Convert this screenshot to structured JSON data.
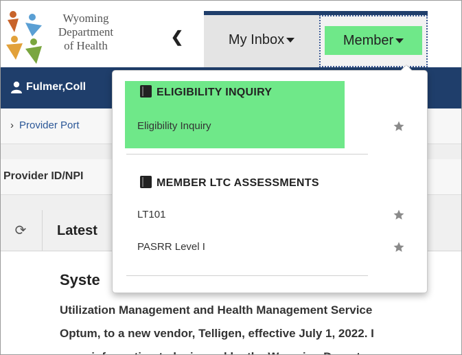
{
  "header": {
    "logo_lines": [
      "Wyoming",
      "Department",
      "of Health"
    ],
    "collapse_icon": "chevron-left-icon",
    "nav": {
      "inbox_label": "My Inbox",
      "member_label": "Member"
    }
  },
  "user": {
    "name": "Fulmer,Coll",
    "icon": "user-icon"
  },
  "breadcrumb": {
    "link": "Provider Port"
  },
  "provider_search": {
    "label": "Provider ID/NPI"
  },
  "panel": {
    "title": "Latest",
    "refresh_icon": "refresh-icon",
    "system_title": "Syste",
    "lines": [
      "Utilization Management and Health Management Service",
      "Optum, to a new vendor, Telligen, effective July 1, 2022. I",
      "more information to be issued by the Wyoming Departm"
    ]
  },
  "dropdown": {
    "sections": [
      {
        "title": "ELIGIBILITY INQUIRY",
        "icon": "book-icon",
        "items": [
          {
            "label": "Eligibility Inquiry",
            "icon": "star-icon"
          }
        ]
      },
      {
        "title": "MEMBER LTC ASSESSMENTS",
        "icon": "book-icon",
        "items": [
          {
            "label": "LT101",
            "icon": "star-icon"
          },
          {
            "label": "PASRR Level I",
            "icon": "star-icon"
          }
        ]
      }
    ]
  },
  "colors": {
    "nav_dark": "#1f3e6b",
    "highlight_green": "#6fe889",
    "link_blue": "#2b5797"
  }
}
